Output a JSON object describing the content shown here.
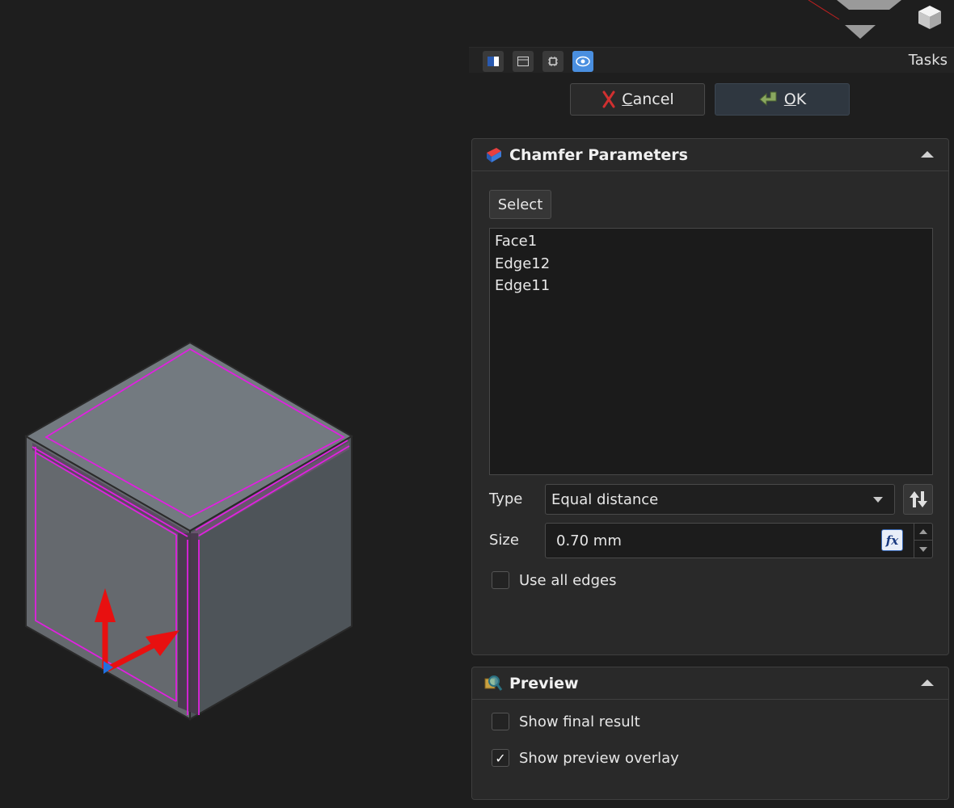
{
  "tasks": {
    "title": "Tasks",
    "cancel_label": "Cancel",
    "cancel_mnemonic": "C",
    "cancel_rest": "ancel",
    "ok_mnemonic": "O",
    "ok_rest": "K"
  },
  "chamfer": {
    "title": "Chamfer Parameters",
    "select_label": "Select",
    "references": [
      "Face1",
      "Edge12",
      "Edge11"
    ],
    "type_label": "Type",
    "type_value": "Equal distance",
    "size_label": "Size",
    "size_value": "0.70 mm",
    "fx_label": "fx",
    "use_all_edges_label": "Use all edges",
    "use_all_edges_checked": false
  },
  "preview": {
    "title": "Preview",
    "show_final_label": "Show final result",
    "show_final_checked": false,
    "show_overlay_label": "Show preview overlay",
    "show_overlay_checked": true,
    "check_mark": "✓"
  },
  "colors": {
    "background": "#1e1e1e",
    "highlight": "#e020e0",
    "axis_x": "#e81010",
    "axis_z": "#2070e0",
    "tab_active": "#4a8fe0"
  }
}
